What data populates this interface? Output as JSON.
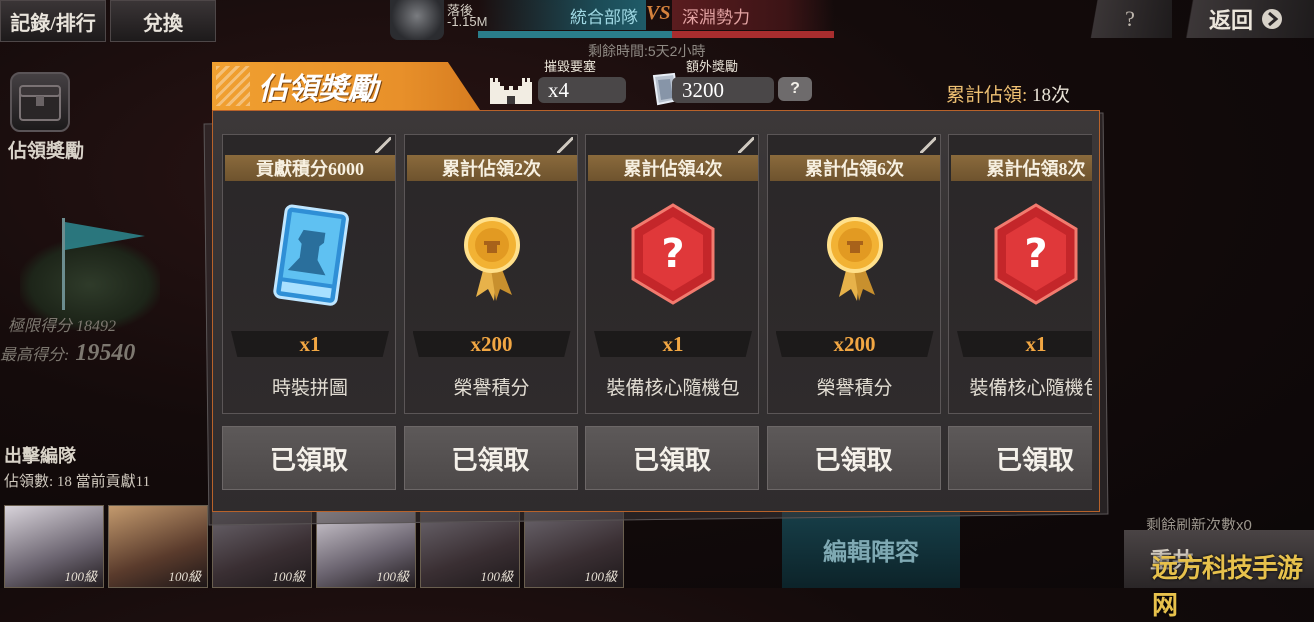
{
  "top_bar": {
    "record_rank_label": "記錄/排行",
    "exchange_label": "兌換",
    "player_name": "落後",
    "player_score": "-1.15M",
    "faction_a": "統合部隊",
    "faction_vs": "VS",
    "faction_b": "深淵勢力",
    "remaining_time": "剩餘時間:5天2小時",
    "help_label": "?",
    "back_label": "返回",
    "back_icon": "chevron-right-icon"
  },
  "sidebar": {
    "occupy_reward_label": "佔領獎勵",
    "limit_score_label": "極限得分 18492",
    "best_score_label": "最高得分:",
    "best_score_value": "19540"
  },
  "team": {
    "title": "出擊編隊",
    "stats": "佔領數: 18  當前貢獻11",
    "members": [
      {
        "level": "100級",
        "tone": "pale"
      },
      {
        "level": "100級",
        "tone": "warm"
      },
      {
        "level": "100級",
        "tone": "dark"
      },
      {
        "level": "100級",
        "tone": "pale"
      },
      {
        "level": "100級",
        "tone": "dark"
      },
      {
        "level": "100級",
        "tone": "dark"
      }
    ],
    "edit_label": "編輯陣容",
    "refresh_count_label": "剩餘刷新次數x0",
    "refresh_button_label": "重共"
  },
  "modal": {
    "title": "佔領獎勵",
    "destroy_fortress_label": "摧毀要塞",
    "destroy_fortress_value": "x4",
    "extra_reward_label": "額外獎勵",
    "extra_reward_value": "3200",
    "help_label": "?",
    "total_occupy_label": "累計佔領:",
    "total_occupy_value": "18次",
    "rewards": [
      {
        "requirement": "貢獻積分6000",
        "icon": "outfit-puzzle-icon",
        "quantity": "x1",
        "name": "時裝拼圖",
        "button": "已領取"
      },
      {
        "requirement": "累計佔領2次",
        "icon": "honor-medal-icon",
        "quantity": "x200",
        "name": "榮譽積分",
        "button": "已領取"
      },
      {
        "requirement": "累計佔領4次",
        "icon": "mystery-core-icon",
        "quantity": "x1",
        "name": "裝備核心隨機包",
        "button": "已領取"
      },
      {
        "requirement": "累計佔領6次",
        "icon": "honor-medal-icon",
        "quantity": "x200",
        "name": "榮譽積分",
        "button": "已領取"
      },
      {
        "requirement": "累計佔領8次",
        "icon": "mystery-core-icon",
        "quantity": "x1",
        "name": "裝備核心隨機包",
        "button": "已領取"
      }
    ]
  },
  "watermark": "远方科技手游网",
  "colors": {
    "accent_orange": "#e8902a",
    "quantity_orange": "#f2a743",
    "faction_blue": "#2a7d8a",
    "faction_red": "#a82d2e"
  }
}
